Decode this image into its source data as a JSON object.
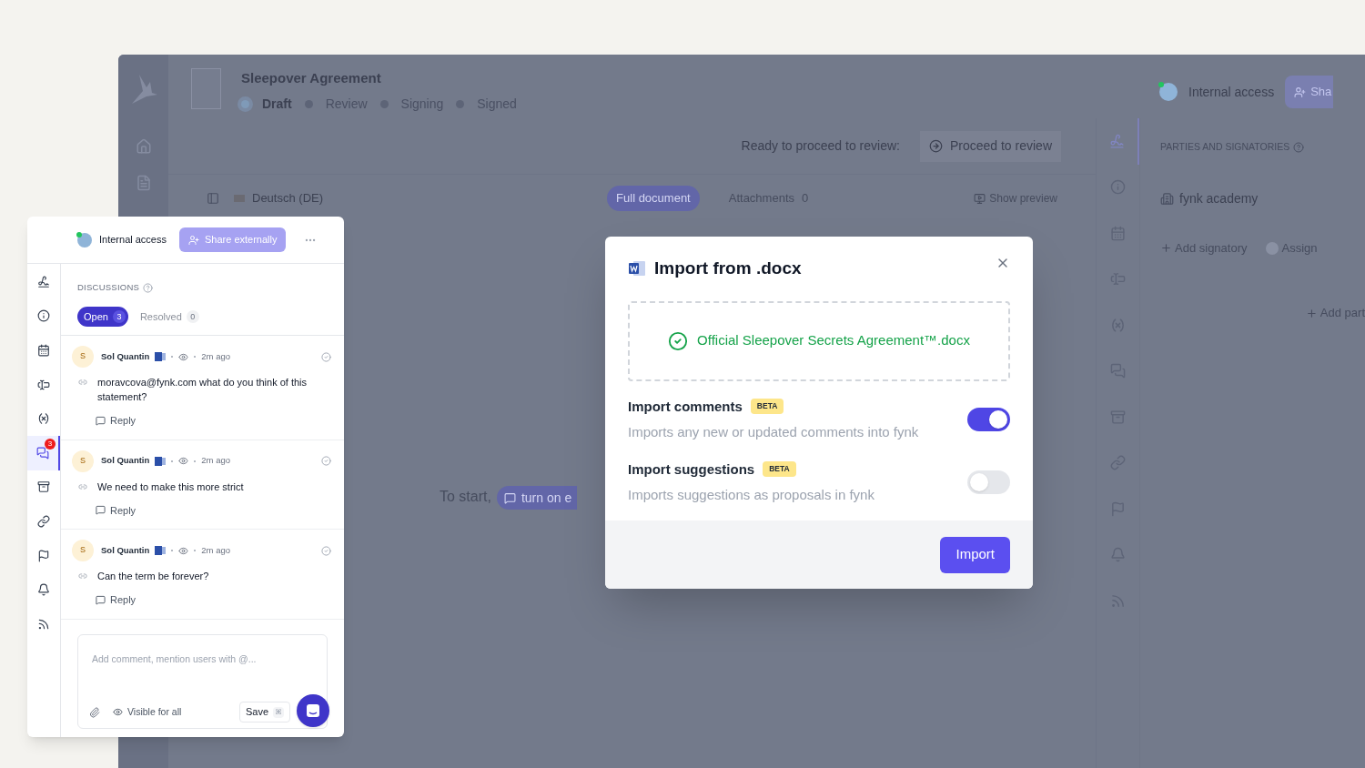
{
  "app": {
    "title": "Sleepover Agreement",
    "stages": [
      {
        "label": "Draft",
        "selected": true
      },
      {
        "label": "Review",
        "selected": false
      },
      {
        "label": "Signing",
        "selected": false
      },
      {
        "label": "Signed",
        "selected": false
      }
    ],
    "access": "Internal access",
    "share_button": "Sha",
    "proceed_prompt": "Ready to proceed to review:",
    "proceed_button": "Proceed to review",
    "language": "Deutsch (DE)",
    "view_tabs": [
      {
        "label": "Full document",
        "selected": true
      },
      {
        "label": "Attachments",
        "count": "0",
        "selected": false
      }
    ],
    "preview_button": "Show preview",
    "empty_prompt": "To start,",
    "empty_button": "turn on e",
    "rail": [
      {
        "selected": true
      },
      {
        "selected": false
      },
      {
        "selected": false
      },
      {
        "selected": false
      },
      {
        "selected": false
      },
      {
        "selected": false
      },
      {
        "selected": false
      },
      {
        "selected": false
      },
      {
        "selected": false
      },
      {
        "selected": false
      },
      {
        "selected": false
      }
    ],
    "parties": {
      "heading": "PARTIES AND SIGNATORIES",
      "party": "fynk academy",
      "add_signatory": "Add signatory",
      "assign": "Assign",
      "add_party": "Add part"
    }
  },
  "comments_panel": {
    "access": "Internal access",
    "share_button": "Share externally",
    "heading": "DISCUSSIONS",
    "filters": [
      {
        "label": "Open",
        "count": "3",
        "selected": true
      },
      {
        "label": "Resolved",
        "count": "0",
        "selected": false
      }
    ],
    "rail": [
      {
        "selected": false
      },
      {
        "selected": false
      },
      {
        "selected": false
      },
      {
        "selected": false
      },
      {
        "selected": false
      },
      {
        "selected": true,
        "badge": "3"
      },
      {
        "selected": false
      },
      {
        "selected": false
      },
      {
        "selected": false
      },
      {
        "selected": false
      },
      {
        "selected": false
      }
    ],
    "comments": [
      {
        "avatar": "S",
        "author": "Sol Quantin",
        "time": "2m ago",
        "text": "moravcova@fynk.com what do you think of this statement?",
        "reply": "Reply"
      },
      {
        "avatar": "S",
        "author": "Sol Quantin",
        "time": "2m ago",
        "text": "We need to make this more strict",
        "reply": "Reply"
      },
      {
        "avatar": "S",
        "author": "Sol Quantin",
        "time": "2m ago",
        "text": "Can the term be forever?",
        "reply": "Reply"
      }
    ],
    "composer": {
      "placeholder": "Add comment, mention users with @...",
      "visibility": "Visible for all",
      "save_button": "Save",
      "shortcut": "⌘"
    }
  },
  "dialog": {
    "title": "Import from .docx",
    "file": "Official Sleepover Secrets Agreement™.docx",
    "options": [
      {
        "title": "Import comments",
        "badge": "BETA",
        "description": "Imports any new or updated comments into fynk",
        "on": true
      },
      {
        "title": "Import suggestions",
        "badge": "BETA",
        "description": "Imports suggestions as proposals in fynk",
        "on": false
      }
    ],
    "button": "Import"
  }
}
